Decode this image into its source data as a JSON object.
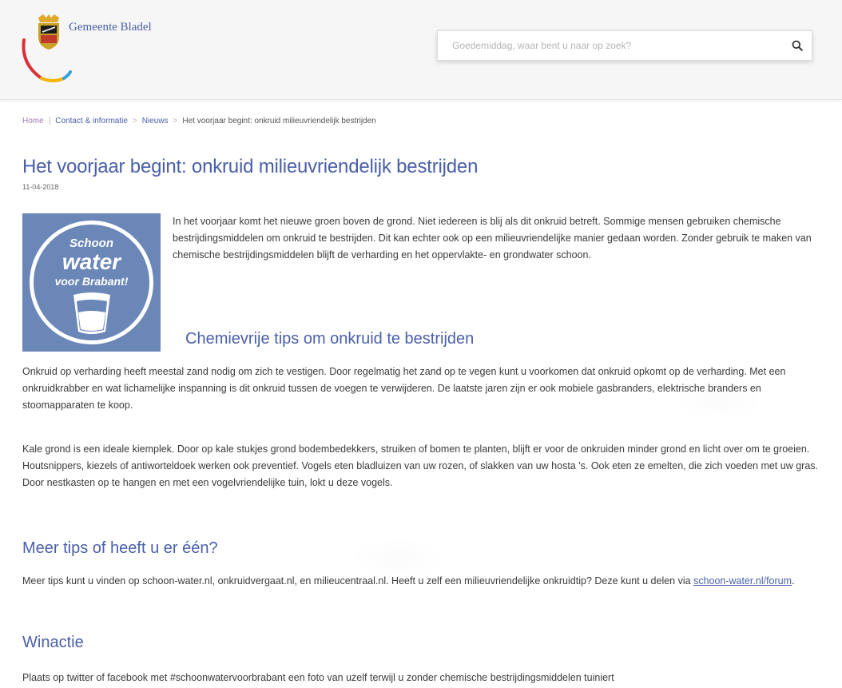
{
  "header": {
    "logo_text": "Gemeente Bladel",
    "search_placeholder": "Goedemiddag, waar bent u naar op zoek?"
  },
  "breadcrumb": {
    "home": "Home",
    "contact": "Contact & informatie",
    "nieuws": "Nieuws",
    "current": "Het voorjaar begint: onkruid milieuvriendelijk bestrijden"
  },
  "article": {
    "title": "Het voorjaar begint: onkruid milieuvriendelijk bestrijden",
    "date": "11-04-2018",
    "image": {
      "line1": "Schoon",
      "line2": "water",
      "line3": "voor Brabant!",
      "color": "#6b87b8"
    },
    "intro": "In het voorjaar komt het nieuwe groen boven de grond. Niet iedereen is blij als dit onkruid betreft. Sommige mensen gebruiken chemische bestrijdingsmiddelen om onkruid te bestrijden. Dit kan echter ook op een milieuvriendelijke manier gedaan worden. Zonder gebruik te maken van chemische bestrijdingsmiddelen blijft de verharding en het oppervlakte- en grondwater schoon.",
    "heading_chem": "Chemievrije tips om onkruid te bestrijden",
    "para1": "Onkruid op verharding heeft meestal zand nodig om zich te vestigen. Door regelmatig het zand op te vegen kunt u voorkomen dat onkruid opkomt op de verharding. Met een onkruidkrabber en wat lichamelijke inspanning is dit onkruid tussen de voegen te verwijderen. De laatste jaren zijn er ook mobiele gasbranders, elektrische branders en stoomapparaten te koop.",
    "para2": "Kale grond is een ideale kiemplek. Door op kale stukjes grond bodembedekkers, struiken of bomen te planten, blijft er voor de onkruiden minder grond en licht over om te groeien. Houtsnippers, kiezels of antiworteldoek werken ook preventief. Vogels eten bladluizen van uw rozen, of slakken van uw hosta 's. Ook eten ze emelten, die zich voeden met uw gras. Door nestkasten op te hangen en met een vogelvriendelijke tuin, lokt u deze vogels.",
    "heading_meer": "Meer tips of heeft u er één?",
    "para3_text": "Meer tips kunt u vinden op schoon-water.nl, onkruidvergaat.nl, en milieucentraal.nl. Heeft u zelf een milieuvriendelijke onkruidtip? Deze kunt u delen via ",
    "para3_link": "schoon-water.nl/forum",
    "para3_end": ".",
    "heading_win": "Winactie",
    "para4": "Plaats op twitter of facebook met #schoonwatervoorbrabant een foto van uzelf terwijl u zonder chemische bestrijdingsmiddelen tuiniert"
  },
  "colors": {
    "accent": "#4a5fa8",
    "image_blue": "#6b87b8"
  }
}
